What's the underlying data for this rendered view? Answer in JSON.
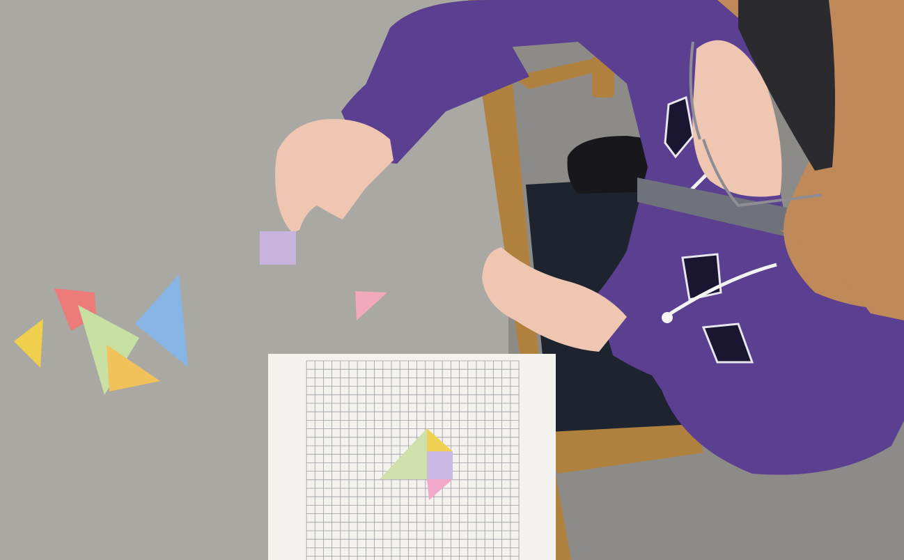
{
  "scene": {
    "colors": {
      "table": "#a9a8a3",
      "carpet": "#8d8b87",
      "chair_wood": "#b0803f",
      "sweatshirt": "#5b3f90",
      "skin": "#eec6b1",
      "hair": "#c0895a",
      "headband": "#2b2b2f",
      "paper": "#f3f2ef",
      "grid_line": "#9b9aa3"
    },
    "tangram_pieces": [
      {
        "name": "yellow-small-triangle",
        "color": "#f0cf4c"
      },
      {
        "name": "red-triangle",
        "color": "#ec7b7a"
      },
      {
        "name": "green-large-triangle",
        "color": "#c9e0a3"
      },
      {
        "name": "blue-large-triangle",
        "color": "#87b6e6"
      },
      {
        "name": "orange-triangle",
        "color": "#f1c25a"
      },
      {
        "name": "lavender-square",
        "color": "#c8b4dc"
      },
      {
        "name": "pink-small-triangle",
        "color": "#f3a9bd"
      }
    ],
    "worksheet_shape_pieces": [
      {
        "name": "worksheet-green-triangle",
        "color": "#cfe0ab"
      },
      {
        "name": "worksheet-yellow-triangle",
        "color": "#f1d154"
      },
      {
        "name": "worksheet-lavender-square",
        "color": "#cdb9e6"
      },
      {
        "name": "worksheet-pink-triangle",
        "color": "#f2a8c8"
      }
    ]
  }
}
